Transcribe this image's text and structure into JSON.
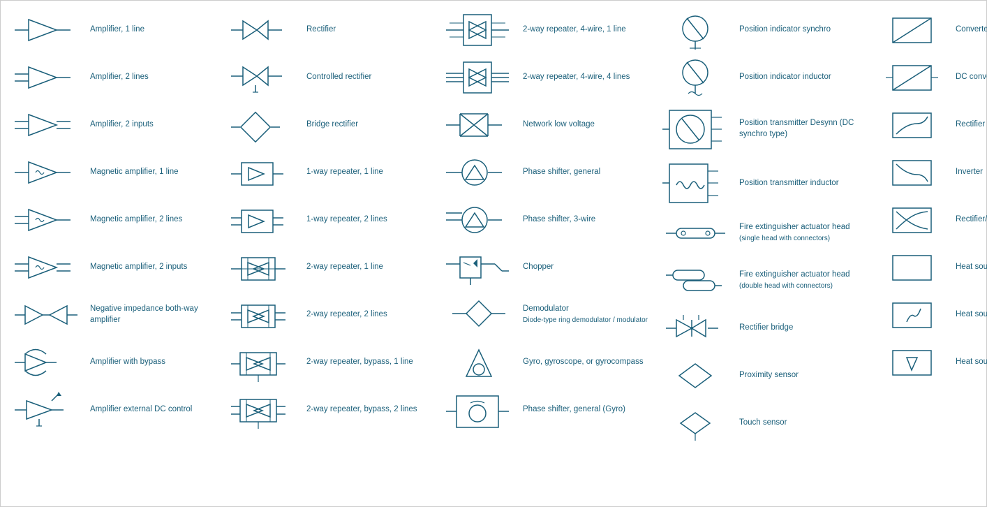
{
  "columns": [
    {
      "id": "col1",
      "items": [
        {
          "id": "amp1",
          "label": "Amplifier, 1 line",
          "symbol": "amp1"
        },
        {
          "id": "amp2",
          "label": "Amplifier, 2 lines",
          "symbol": "amp2"
        },
        {
          "id": "amp2in",
          "label": "Amplifier, 2 inputs",
          "symbol": "amp2in"
        },
        {
          "id": "magamp1",
          "label": "Magnetic amplifier, 1 line",
          "symbol": "magamp1"
        },
        {
          "id": "magamp2",
          "label": "Magnetic amplifier, 2 lines",
          "symbol": "magamp2"
        },
        {
          "id": "magamp2in",
          "label": "Magnetic amplifier, 2 inputs",
          "symbol": "magamp2in"
        },
        {
          "id": "negamp",
          "label": "Negative impedance both-way amplifier",
          "symbol": "negamp"
        },
        {
          "id": "ampbypass",
          "label": "Amplifier with bypass",
          "symbol": "ampbypass"
        },
        {
          "id": "ampdc",
          "label": "Amplifier external DC control",
          "symbol": "ampdc"
        }
      ]
    },
    {
      "id": "col2",
      "items": [
        {
          "id": "rect",
          "label": "Rectifier",
          "symbol": "rect"
        },
        {
          "id": "crect",
          "label": "Controlled rectifier",
          "symbol": "crect"
        },
        {
          "id": "bridge",
          "label": "Bridge rectifier",
          "symbol": "bridge"
        },
        {
          "id": "rep1w1l",
          "label": "1-way repeater, 1 line",
          "symbol": "rep1w1l"
        },
        {
          "id": "rep1w2l",
          "label": "1-way repeater, 2 lines",
          "symbol": "rep1w2l"
        },
        {
          "id": "rep2w1l",
          "label": "2-way repeater, 1 line",
          "symbol": "rep2w1l"
        },
        {
          "id": "rep2w2l",
          "label": "2-way repeater, 2 lines",
          "symbol": "rep2w2l"
        },
        {
          "id": "rep2wb1l",
          "label": "2-way repeater, bypass, 1 line",
          "symbol": "rep2wb1l"
        },
        {
          "id": "rep2wb2l",
          "label": "2-way repeater, bypass, 2 lines",
          "symbol": "rep2wb2l"
        }
      ]
    },
    {
      "id": "col3",
      "items": [
        {
          "id": "rep2w4w1l",
          "label": "2-way repeater, 4-wire, 1 line",
          "symbol": "rep2w4w1l"
        },
        {
          "id": "rep2w4w4l",
          "label": "2-way repeater, 4-wire, 4 lines",
          "symbol": "rep2w4w4l"
        },
        {
          "id": "netlv",
          "label": "Network low voltage",
          "symbol": "netlv"
        },
        {
          "id": "phshift",
          "label": "Phase shifter, general",
          "symbol": "phshift"
        },
        {
          "id": "phshift3",
          "label": "Phase shifter, 3-wire",
          "symbol": "phshift3"
        },
        {
          "id": "chopper",
          "label": "Chopper",
          "symbol": "chopper"
        },
        {
          "id": "demod",
          "label": "Demodulator",
          "sublabel": "Diode-type ring demodulator / modulator",
          "symbol": "demod"
        },
        {
          "id": "gyro",
          "label": "Gyro, gyroscope, or gyrocompass",
          "symbol": "gyro"
        },
        {
          "id": "phshiftgyro",
          "label": "Phase shifter, general (Gyro)",
          "symbol": "phshiftgyro"
        }
      ]
    },
    {
      "id": "col4",
      "items": [
        {
          "id": "posindsynchro",
          "label": "Position indicator synchro",
          "symbol": "posindsynchro"
        },
        {
          "id": "posindinductor",
          "label": "Position indicator inductor",
          "symbol": "posindinductor"
        },
        {
          "id": "postransdesynn",
          "label": "Position transmitter Desynn (DC synchro type)",
          "symbol": "postransdesynn"
        },
        {
          "id": "postransinductor",
          "label": "Position transmitter inductor",
          "symbol": "postransinductor"
        },
        {
          "id": "fireact1",
          "label": "Fire extinguisher actuator head",
          "sublabel": "(single head with connectors)",
          "symbol": "fireact1"
        },
        {
          "id": "fireact2",
          "label": "Fire extinguisher actuator head",
          "sublabel": "(double head with connectors)",
          "symbol": "fireact2"
        },
        {
          "id": "rectbridge",
          "label": "Rectifier bridge",
          "symbol": "rectbridge"
        },
        {
          "id": "proxsensor",
          "label": "Proximity sensor",
          "symbol": "proxsensor"
        },
        {
          "id": "touchsensor",
          "label": "Touch sensor",
          "symbol": "touchsensor"
        }
      ]
    },
    {
      "id": "col5",
      "items": [
        {
          "id": "convgen",
          "label": "Converter, general",
          "symbol": "convgen"
        },
        {
          "id": "dcconv",
          "label": "DC converter",
          "symbol": "dcconv"
        },
        {
          "id": "rectifier2",
          "label": "Rectifier",
          "symbol": "rectifier2"
        },
        {
          "id": "inverter",
          "label": "Inverter",
          "symbol": "inverter"
        },
        {
          "id": "rectinv",
          "label": "Rectifier/inverter",
          "symbol": "rectinv"
        },
        {
          "id": "heatsrc",
          "label": "Heat source, general",
          "symbol": "heatsrc"
        },
        {
          "id": "heatrad",
          "label": "Heat source, radioisotope",
          "symbol": "heatrad"
        },
        {
          "id": "heatcomb",
          "label": "Heat source, combustion",
          "symbol": "heatcomb"
        }
      ]
    }
  ]
}
